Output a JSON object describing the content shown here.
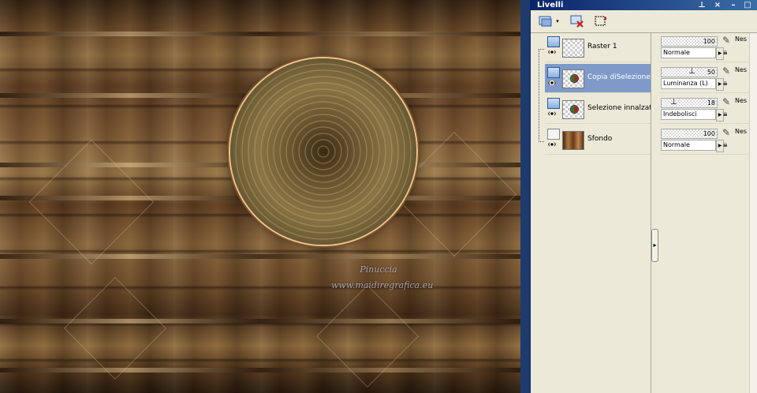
{
  "canvas": {
    "watermark_line1": "Pinuccia",
    "watermark_line2": "www.maidiregrafica.eu"
  },
  "panel": {
    "title": "Livelli",
    "title_controls": [
      "pin-icon",
      "close-icon",
      "minimize-icon",
      "maximize-icon"
    ],
    "toolbar": [
      {
        "name": "new-layer-icon"
      },
      {
        "name": "dropdown-icon"
      },
      {
        "name": "delete-layer-icon"
      },
      {
        "name": "selection-icon"
      }
    ],
    "layers": [
      {
        "name": "Raster 1",
        "type": "raster",
        "opacity": "100",
        "blend": "Normale",
        "selected": false
      },
      {
        "name": "Copia diSelezione",
        "type": "raster",
        "opacity": "50",
        "blend": "Luminanza (L)",
        "selected": true
      },
      {
        "name": "Selezione innalzata",
        "type": "raster",
        "opacity": "18",
        "blend": "Indebolisci",
        "selected": false
      },
      {
        "name": "Sfondo",
        "type": "background",
        "opacity": "100",
        "blend": "Normale",
        "selected": false
      }
    ],
    "truncated_label": "Nes",
    "colors": {
      "titlebar": "#0a246a",
      "selection": "#7f9ac9"
    }
  }
}
